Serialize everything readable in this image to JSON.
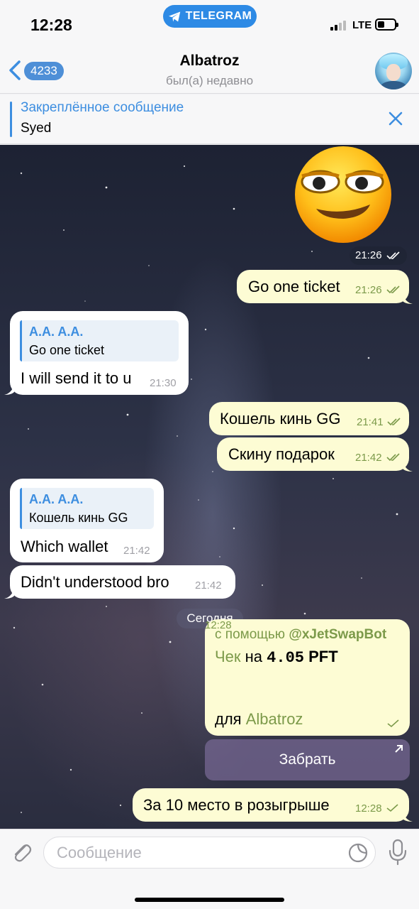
{
  "status_bar": {
    "time": "12:28",
    "app_pill": "TELEGRAM",
    "network": "LTE"
  },
  "header": {
    "back_badge": "4233",
    "title": "Albatroz",
    "subtitle": "был(а) недавно"
  },
  "pinned": {
    "title": "Закреплённое сообщение",
    "text": "Syed"
  },
  "messages": {
    "sticker_time": "21:26",
    "m1": {
      "text": "Go one ticket",
      "time": "21:26"
    },
    "m2": {
      "reply_name": "A.A. A.A.",
      "reply_text": "Go one ticket",
      "text": "I will send it to u",
      "time": "21:30"
    },
    "m3": {
      "text": "Кошель кинь GG",
      "time": "21:41"
    },
    "m4": {
      "text": "Скину подарок",
      "time": "21:42"
    },
    "m5": {
      "reply_name": "A.A. A.A.",
      "reply_text": "Кошель кинь GG",
      "text": "Which wallet",
      "time": "21:42"
    },
    "m6": {
      "text": "Didn't understood bro",
      "time": "21:42"
    },
    "date_chip": "Сегодня",
    "cheque": {
      "via_prefix": "с помощью",
      "via_bot": "@xJetSwapBot",
      "label": "Чек",
      "on": "на",
      "amount": "4.05",
      "currency": "PFT",
      "for_prefix": "для",
      "for_name": "Albatroz",
      "time": "12:28",
      "button": "Забрать"
    },
    "m7": {
      "text": "За 10 место в розыгрыше",
      "time": "12:28"
    }
  },
  "input": {
    "placeholder": "Сообщение"
  },
  "colors": {
    "accent": "#3d8ee0",
    "outgoing_bubble": "#fdfcd4",
    "outgoing_meta": "#7c9a4a",
    "telegram_pill": "#2d8ae5"
  }
}
